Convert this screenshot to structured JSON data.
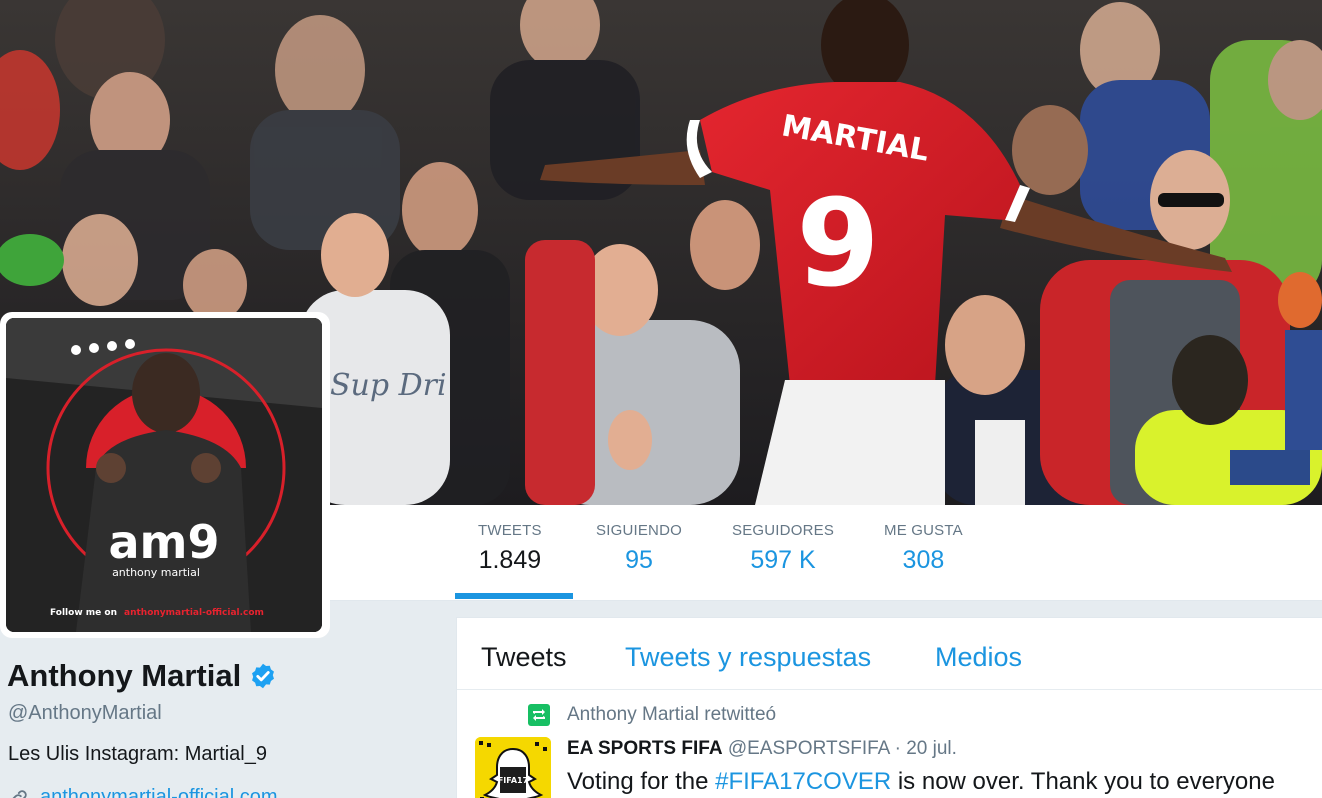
{
  "stats": {
    "tweets": {
      "label": "TWEETS",
      "value": "1.849"
    },
    "following": {
      "label": "SIGUIENDO",
      "value": "95"
    },
    "followers": {
      "label": "SEGUIDORES",
      "value": "597 K"
    },
    "likes": {
      "label": "ME GUSTA",
      "value": "308"
    }
  },
  "profile": {
    "name": "Anthony Martial",
    "handle": "@AnthonyMartial",
    "bio": "Les Ulis Instagram: Martial_9",
    "website": "anthonymartial-official.com",
    "verified": true
  },
  "header_photo": {
    "jersey_name": "MARTIAL",
    "jersey_number": "9"
  },
  "avatar_image": {
    "logo_text": "am9",
    "logo_subtext": "anthony martial",
    "follow_prefix": "Follow me on",
    "follow_site": "anthonymartial-official.com"
  },
  "timeline": {
    "tabs": [
      "Tweets",
      "Tweets y respuestas",
      "Medios"
    ],
    "active_tab": "Tweets",
    "tweet": {
      "retweet_context": "Anthony Martial retwitteó",
      "author": "EA SPORTS FIFA",
      "handle": "@EASPORTSFIFA",
      "separator": "·",
      "date": "20 jul.",
      "text_before": "Voting for the ",
      "hashtag": "#FIFA17COVER",
      "text_after": " is now over. Thank you to everyone",
      "avatar_text": "FIFA17"
    }
  },
  "colors": {
    "accent": "#1b95e0",
    "text": "#14171a",
    "muted": "#657786",
    "retweet_green": "#17bf63",
    "jersey_red": "#d8202a",
    "verified_blue": "#1da1f2"
  },
  "icons": {
    "verified": "verified-badge-icon",
    "link": "link-icon",
    "retweet": "retweet-icon"
  }
}
